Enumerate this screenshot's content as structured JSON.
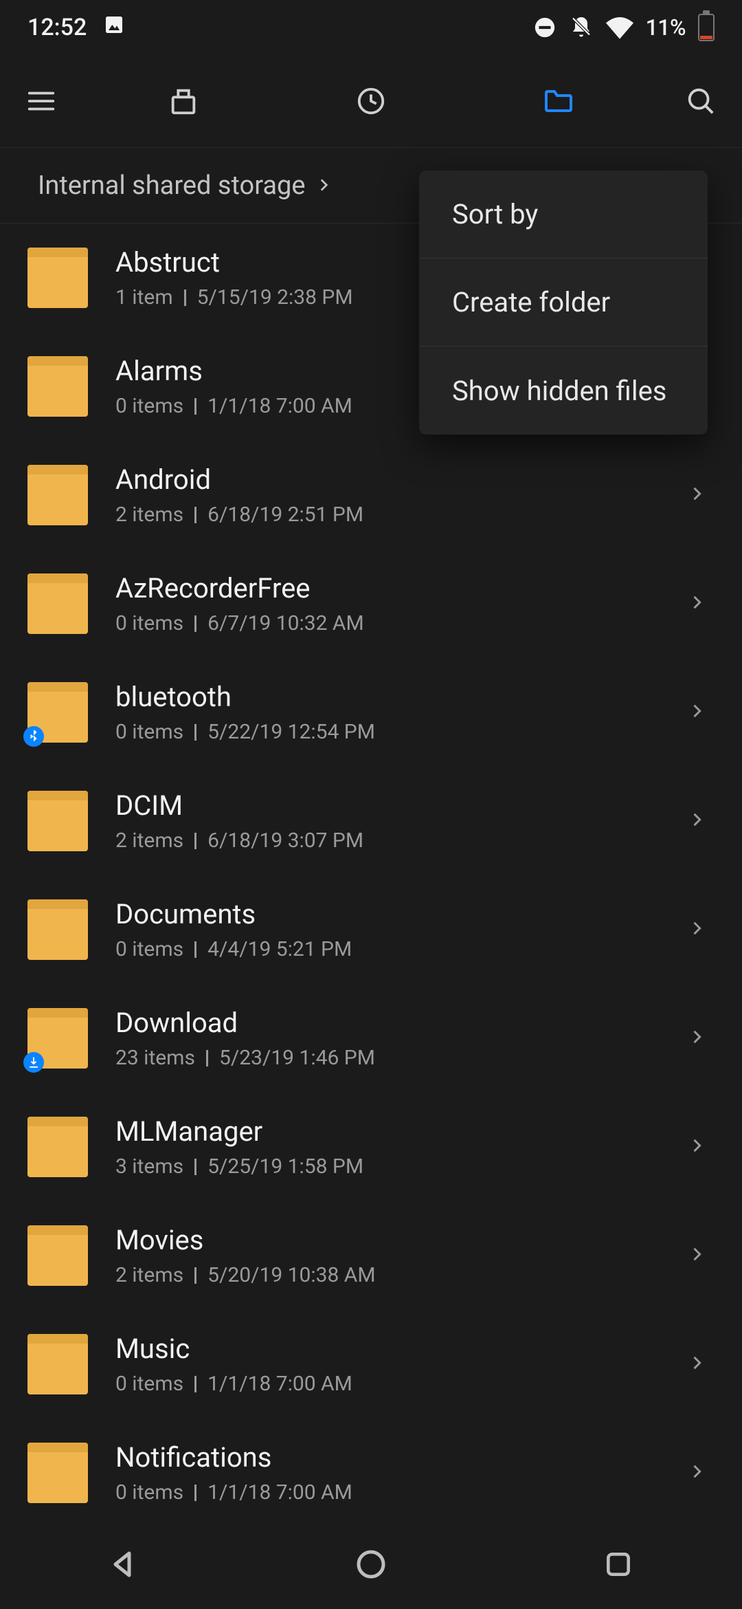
{
  "status": {
    "time": "12:52",
    "battery": "11%"
  },
  "breadcrumb": {
    "label": "Internal shared storage"
  },
  "popup": {
    "items": [
      {
        "label": "Sort by"
      },
      {
        "label": "Create folder"
      },
      {
        "label": "Show hidden files"
      }
    ]
  },
  "folders": [
    {
      "name": "Abstruct",
      "count": "1 item",
      "date": "5/15/19 2:38 PM",
      "chevron": false,
      "badge": null
    },
    {
      "name": "Alarms",
      "count": "0 items",
      "date": "1/1/18 7:00 AM",
      "chevron": false,
      "badge": null
    },
    {
      "name": "Android",
      "count": "2 items",
      "date": "6/18/19 2:51 PM",
      "chevron": true,
      "badge": null
    },
    {
      "name": "AzRecorderFree",
      "count": "0 items",
      "date": "6/7/19 10:32 AM",
      "chevron": true,
      "badge": null
    },
    {
      "name": "bluetooth",
      "count": "0 items",
      "date": "5/22/19 12:54 PM",
      "chevron": true,
      "badge": "bt"
    },
    {
      "name": "DCIM",
      "count": "2 items",
      "date": "6/18/19 3:07 PM",
      "chevron": true,
      "badge": null
    },
    {
      "name": "Documents",
      "count": "0 items",
      "date": "4/4/19 5:21 PM",
      "chevron": true,
      "badge": null
    },
    {
      "name": "Download",
      "count": "23 items",
      "date": "5/23/19 1:46 PM",
      "chevron": true,
      "badge": "dl"
    },
    {
      "name": "MLManager",
      "count": "3 items",
      "date": "5/25/19 1:58 PM",
      "chevron": true,
      "badge": null
    },
    {
      "name": "Movies",
      "count": "2 items",
      "date": "5/20/19 10:38 AM",
      "chevron": true,
      "badge": null
    },
    {
      "name": "Music",
      "count": "0 items",
      "date": "1/1/18 7:00 AM",
      "chevron": true,
      "badge": null
    },
    {
      "name": "Notifications",
      "count": "0 items",
      "date": "1/1/18 7:00 AM",
      "chevron": true,
      "badge": null
    }
  ]
}
